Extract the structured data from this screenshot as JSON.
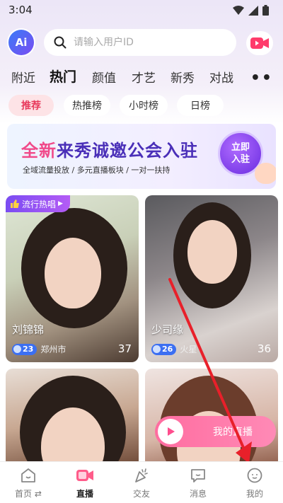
{
  "status": {
    "time": "3:04"
  },
  "search": {
    "placeholder": "请输入用户ID"
  },
  "tabs": [
    {
      "label": "附近"
    },
    {
      "label": "热门"
    },
    {
      "label": "颜值"
    },
    {
      "label": "才艺"
    },
    {
      "label": "新秀"
    },
    {
      "label": "对战"
    }
  ],
  "chips": [
    {
      "label": "推荐"
    },
    {
      "label": "热推榜"
    },
    {
      "label": "小时榜"
    },
    {
      "label": "日榜"
    }
  ],
  "banner": {
    "title_pink": "全新",
    "title_rest": "来秀诚邀公会入驻",
    "subtitle": "全域流量投放 / 多元直播板块 / 一对一扶持",
    "button": "立即入驻"
  },
  "cards": [
    {
      "badge": "流行热唱",
      "name": "刘锦锦",
      "level": "23",
      "location": "郑州市",
      "count": "37"
    },
    {
      "name": "少司缘",
      "level": "26",
      "location": "火星",
      "count": "36"
    }
  ],
  "floating": {
    "label": "我的直播"
  },
  "nav": [
    {
      "label": "首页"
    },
    {
      "label": "直播"
    },
    {
      "label": "交友"
    },
    {
      "label": "消息"
    },
    {
      "label": "我的"
    }
  ],
  "colors": {
    "accent": "#e83a5c",
    "purple": "#6a2ce0",
    "level": "#3b6ff2",
    "pill": "#ff6da0",
    "arrow": "#e8202a"
  }
}
